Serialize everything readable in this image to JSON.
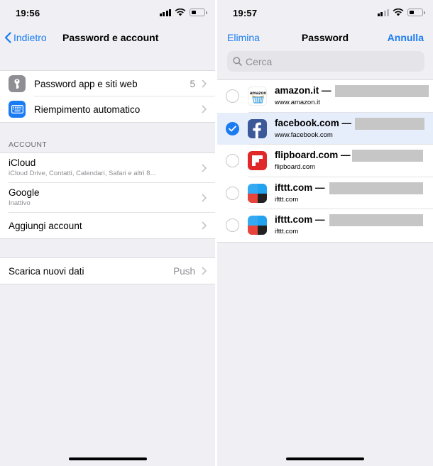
{
  "left": {
    "status": {
      "time": "19:56"
    },
    "nav": {
      "back_label": "Indietro",
      "title": "Password e account"
    },
    "group1": [
      {
        "label": "Password app e siti web",
        "value": "5",
        "icon": "key-icon",
        "color": "#8e8e93"
      },
      {
        "label": "Riempimento automatico",
        "value": "",
        "icon": "keyboard-icon",
        "color": "#1a7cf2"
      }
    ],
    "account_header": "ACCOUNT",
    "accounts": [
      {
        "label": "iCloud",
        "sub": "iCloud Drive, Contatti, Calendari, Safari e altri 8..."
      },
      {
        "label": "Google",
        "sub": "Inattivo"
      },
      {
        "label": "Aggiungi account",
        "sub": ""
      }
    ],
    "fetch": {
      "label": "Scarica nuovi dati",
      "value": "Push"
    }
  },
  "right": {
    "status": {
      "time": "19:57"
    },
    "nav": {
      "left_label": "Elimina",
      "title": "Password",
      "right_label": "Annulla"
    },
    "search": {
      "placeholder": "Cerca",
      "value": ""
    },
    "items": [
      {
        "site": "amazon.it",
        "dash": " —",
        "url": "www.amazon.it",
        "selected": false,
        "icon": "amazon-icon"
      },
      {
        "site": "facebook.com",
        "dash": " —",
        "url": "www.facebook.com",
        "selected": true,
        "icon": "facebook-icon"
      },
      {
        "site": "flipboard.com",
        "dash": " —",
        "url": "flipboard.com",
        "selected": false,
        "icon": "flipboard-icon"
      },
      {
        "site": "ifttt.com",
        "dash": " —",
        "url": "ifttt.com",
        "selected": false,
        "icon": "ifttt-icon"
      },
      {
        "site": "ifttt.com",
        "dash": " —",
        "url": "ifttt.com",
        "selected": false,
        "icon": "ifttt-icon"
      }
    ],
    "amazon_logo_text": "amazon"
  },
  "colors": {
    "accent": "#1a7cf2",
    "background": "#efeff4",
    "facebook": "#3b5998",
    "flipboard": "#e12828"
  }
}
